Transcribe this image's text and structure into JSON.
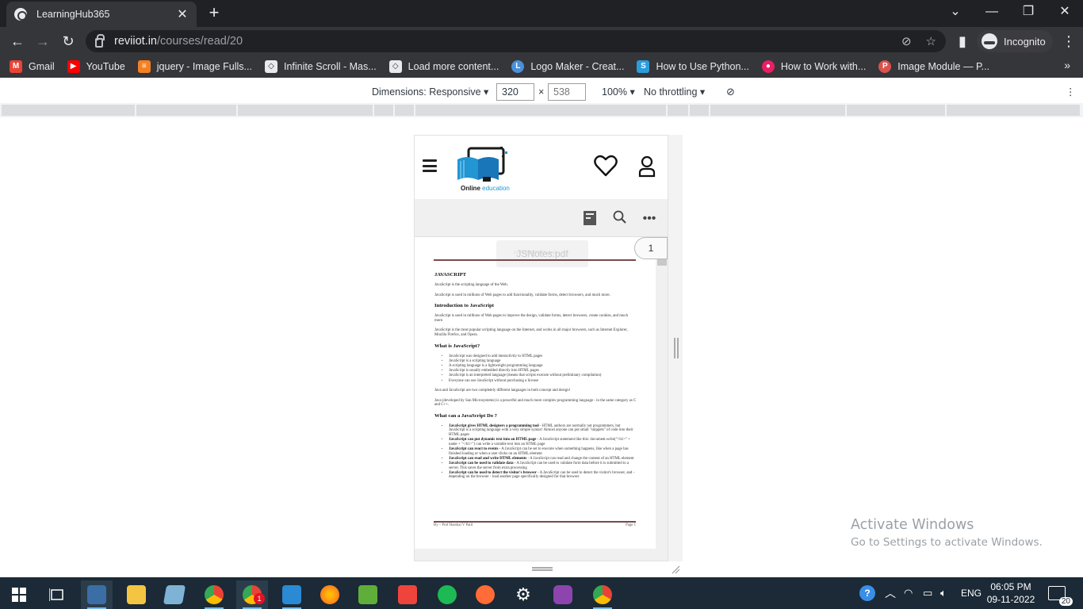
{
  "browser": {
    "tab_title": "LearningHub365",
    "close_tab": "✕",
    "new_tab": "+",
    "url_host": "reviiot.in",
    "url_path": "/courses/read/20",
    "profile_label": "Incognito"
  },
  "bookmarks": [
    {
      "label": "Gmail",
      "icon": "gmail-icon",
      "color": "#ea4335"
    },
    {
      "label": "YouTube",
      "icon": "youtube-icon",
      "color": "#ff0000"
    },
    {
      "label": "jquery - Image Fulls...",
      "icon": "stackoverflow-icon",
      "color": "#f48024"
    },
    {
      "label": "Infinite Scroll - Mas...",
      "icon": "codepen-icon",
      "color": "#e8eaed"
    },
    {
      "label": "Load more content...",
      "icon": "codepen-icon",
      "color": "#e8eaed"
    },
    {
      "label": "Logo Maker - Creat...",
      "icon": "logomaker-icon",
      "color": "#4a90d9"
    },
    {
      "label": "How to Use Python...",
      "icon": "s-icon",
      "color": "#2d9cdb"
    },
    {
      "label": "How to Work with...",
      "icon": "record-icon",
      "color": "#e91e63"
    },
    {
      "label": "Image Module — P...",
      "icon": "python-icon",
      "color": "#d9534f"
    }
  ],
  "devtools": {
    "dimensions_label": "Dimensions: Responsive",
    "width": "320",
    "times": "×",
    "height": "538",
    "zoom": "100%",
    "throttling": "No throttling"
  },
  "site": {
    "logo_text_1": "Online",
    "logo_text_2": "education"
  },
  "pdf": {
    "page_number": "1",
    "file_name": "JSNotes.pdf",
    "header_text": "JAVASCRIPT [Notes]",
    "title": "JAVASCRIPT",
    "p1": "JavaScript is the scripting language of the Web.",
    "p2": "JavaScript is used in millions of Web pages to add functionality, validate forms, detect browsers, and much more.",
    "h_intro": "Introduction to JavaScript",
    "p3": "JavaScript is used in millions of Web pages to improve the design, validate forms, detect browsers, create cookies, and much more.",
    "p4": "JavaScript is the most popular scripting language on the Internet, and works in all major browsers, such as Internet Explorer, Mozilla Firefox, and Opera.",
    "h_what": "What is JavaScript?",
    "what_list": [
      "JavaScript was designed to add interactivity to HTML pages",
      "JavaScript is a scripting language",
      "A scripting language is a lightweight programming language",
      "JavaScript is usually embedded directly into HTML pages",
      "JavaScript is an interpreted language (means that scripts execute without preliminary compilation)",
      "Everyone can use JavaScript without purchasing a license"
    ],
    "p5": "Java and JavaScript are two completely different languages in both concept and design!",
    "p6": "Java (developed by Sun Microsystems) is a powerful and much more complex programming language - in the same category as C and C++.",
    "h_can": "What can a JavaScript Do ?",
    "can_list": [
      {
        "b": "JavaScript gives HTML designers a programming tool",
        "t": " - HTML authors are normally not programmers, but JavaScript is a scripting language with a very simple syntax! Almost anyone can put small \"snippets\" of code into their HTML pages"
      },
      {
        "b": "JavaScript can put dynamic text into an HTML page",
        "t": " - A JavaScript statement like this: document.write(\"<h1>\" + name + \"</h1>\") can write a variable text into an HTML page"
      },
      {
        "b": "JavaScript can react to events",
        "t": " - A JavaScript can be set to execute when something happens, like when a page has finished loading or when a user clicks on an HTML element"
      },
      {
        "b": "JavaScript can read and write HTML elements",
        "t": " - A JavaScript can read and change the content of an HTML element"
      },
      {
        "b": "JavaScript can be used to validate data",
        "t": " - A JavaScript can be used to validate form data before it is submitted to a server. This saves the server from extra processing"
      },
      {
        "b": "JavaScript can be used to detect the visitor's browser",
        "t": " - A JavaScript can be used to detect the visitor's browser, and - depending on the browser - load another page specifically designed for that browser"
      }
    ],
    "footer_left": "By – Prof Harshal V Patil",
    "footer_right": "Page 1"
  },
  "watermark": {
    "line1": "Activate Windows",
    "line2": "Go to Settings to activate Windows."
  },
  "taskbar": {
    "lang": "ENG",
    "time": "06:05 PM",
    "date": "09-11-2022",
    "notifications": "20",
    "chrome_badge": "1"
  }
}
